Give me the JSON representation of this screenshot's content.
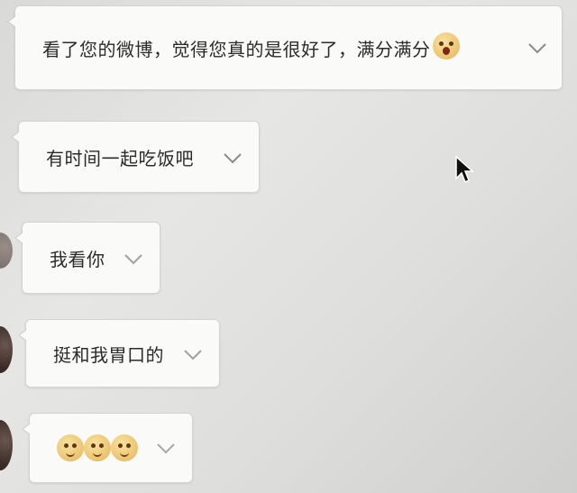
{
  "chat": {
    "messages": [
      {
        "text": "看了您的微博，觉得您真的是很好了，满分满分",
        "trailing_emoji": "face-screaming-emoji",
        "menu_icon": "chevron-down-icon"
      },
      {
        "text": "有时间一起吃饭吧",
        "menu_icon": "chevron-down-icon"
      },
      {
        "text": "我看你",
        "menu_icon": "chevron-down-icon"
      },
      {
        "text": "挺和我胃口的",
        "menu_icon": "chevron-down-icon"
      },
      {
        "text": "",
        "emojis": [
          "cat-face-emoji",
          "cat-face-emoji",
          "cat-face-emoji"
        ],
        "menu_icon": "chevron-down-icon"
      }
    ]
  },
  "colors": {
    "bubble_background": "#fafaf9",
    "bubble_border": "#d3d3d1",
    "text": "#2b2b2b",
    "chevron": "#8a8a8a",
    "emoji_yellow": "#eac06a"
  },
  "cursor": {
    "icon": "arrow-cursor-icon"
  }
}
